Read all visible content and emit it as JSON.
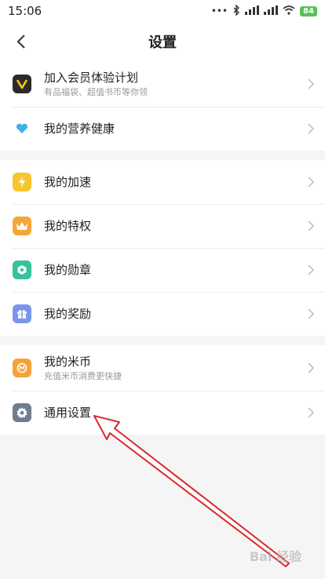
{
  "status": {
    "time": "15:06",
    "battery": "84"
  },
  "header": {
    "title": "设置"
  },
  "groups": [
    {
      "items": [
        {
          "label": "加入会员体验计划",
          "sub": "有品福袋、超值书币等你领",
          "icon": "vip-v-icon",
          "color": "#2b2b2b"
        },
        {
          "label": "我的营养健康",
          "icon": "heart-icon",
          "color": "#3eb4ea"
        }
      ]
    },
    {
      "items": [
        {
          "label": "我的加速",
          "icon": "lightning-icon",
          "color": "#f6c530"
        },
        {
          "label": "我的特权",
          "icon": "crown-icon",
          "color": "#f5a63b"
        },
        {
          "label": "我的勋章",
          "icon": "badge-icon",
          "color": "#35c39b"
        },
        {
          "label": "我的奖励",
          "icon": "gift-icon",
          "color": "#7a96e8"
        }
      ]
    },
    {
      "items": [
        {
          "label": "我的米币",
          "sub": "充值米币消费更快捷",
          "icon": "coin-icon",
          "color": "#f5a23a"
        },
        {
          "label": "通用设置",
          "icon": "gear-icon",
          "color": "#6f7e8c"
        }
      ]
    }
  ],
  "watermark": "Bai 经验"
}
